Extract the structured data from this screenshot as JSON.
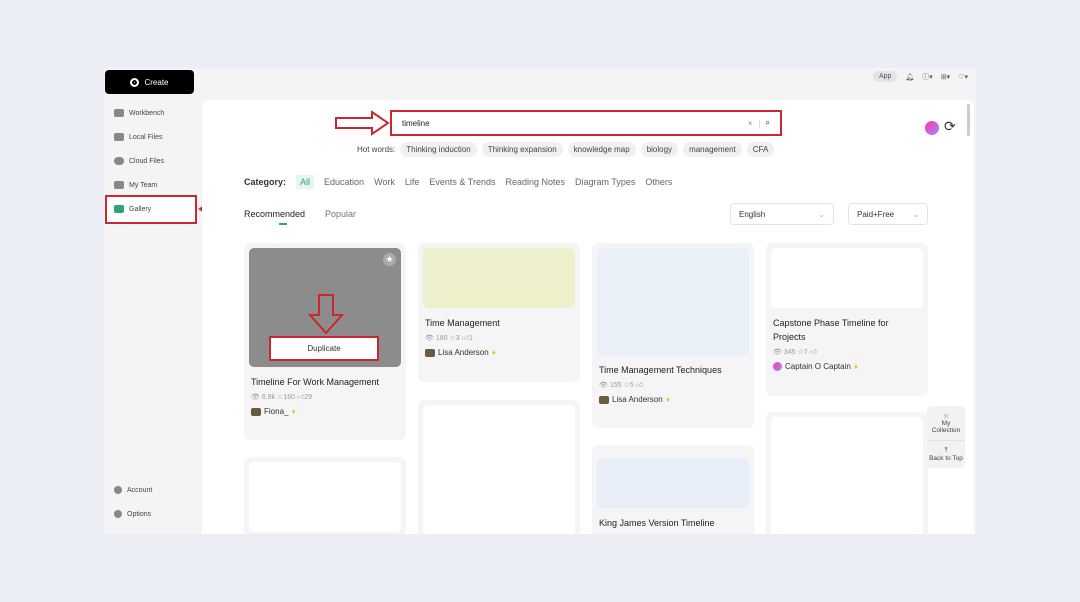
{
  "sidebar": {
    "create": "Create",
    "items": [
      {
        "label": "Workbench"
      },
      {
        "label": "Local Files"
      },
      {
        "label": "Cloud Files"
      },
      {
        "label": "My Team"
      },
      {
        "label": "Gallery"
      }
    ],
    "account": "Account",
    "options": "Options"
  },
  "topbar": {
    "app": "App"
  },
  "search": {
    "value": "timeline",
    "clear": "×"
  },
  "hot": {
    "label": "Hot words:",
    "words": [
      "Thinking induction",
      "Thinking expansion",
      "knowledge map",
      "biology",
      "management",
      "CFA"
    ]
  },
  "category": {
    "label": "Category:",
    "items": [
      "All",
      "Education",
      "Work",
      "Life",
      "Events & Trends",
      "Reading Notes",
      "Diagram Types",
      "Others"
    ]
  },
  "tabs": [
    "Recommended",
    "Popular"
  ],
  "filters": {
    "language": "English",
    "price": "Paid+Free"
  },
  "cards": [
    {
      "title": "Timeline For Work Management",
      "views": "6.9k",
      "stars": "160",
      "likes": "29",
      "author": "Fiona_",
      "action": "Duplicate"
    },
    {
      "title": "Time Management",
      "views": "180",
      "stars": "3",
      "likes": "1",
      "author": "Lisa Anderson"
    },
    {
      "title": "Time Management Techniques",
      "views": "155",
      "stars": "5",
      "likes": "",
      "author": "Lisa Anderson"
    },
    {
      "title": "Capstone Phase Timeline for Projects",
      "views": "345",
      "stars": "7",
      "likes": "",
      "author": "Captain O Captain"
    },
    {
      "title": "King James Version Timeline"
    }
  ],
  "side_panel": {
    "collection": "My Collection",
    "top": "Back to Top"
  },
  "colors": {
    "accent": "#2ea37c",
    "annotation": "#c8282e"
  }
}
